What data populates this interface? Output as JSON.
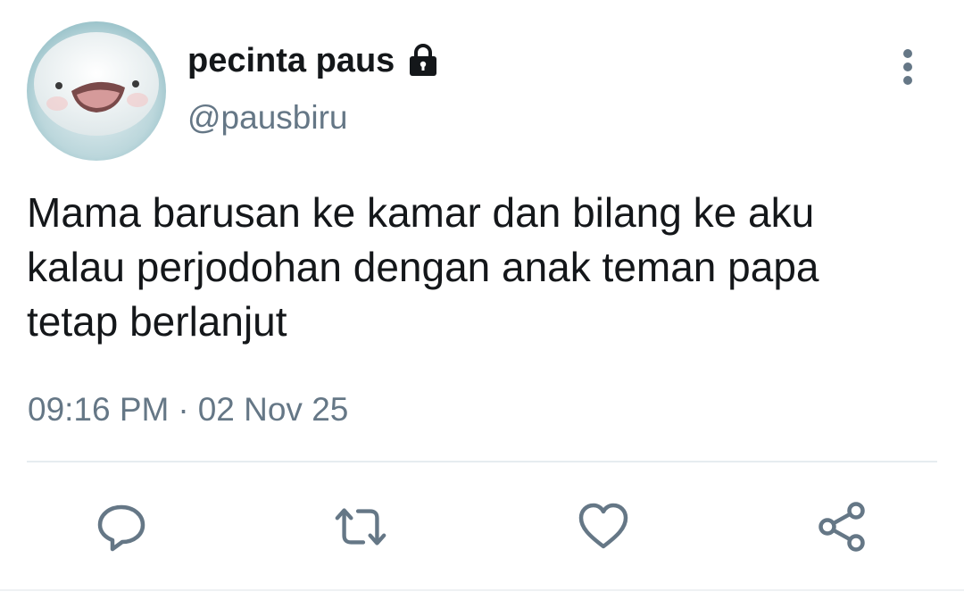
{
  "tweet": {
    "display_name": "pecinta paus",
    "handle": "@pausbiru",
    "locked": true,
    "text_lines": [
      "Mama barusan ke kamar dan bilang ke aku",
      "kalau perjodohan dengan anak teman papa",
      "tetap berlanjut"
    ],
    "time": "09:16 PM",
    "separator": "·",
    "date": "02 Nov 25"
  },
  "icons": {
    "lock": "lock-icon",
    "more": "more-vertical-icon",
    "reply": "reply-icon",
    "retweet": "retweet-icon",
    "like": "heart-icon",
    "share": "share-icon"
  },
  "colors": {
    "text_primary": "#14171a",
    "text_secondary": "#657786",
    "icon": "#657786",
    "divider": "#e6ecf0"
  }
}
